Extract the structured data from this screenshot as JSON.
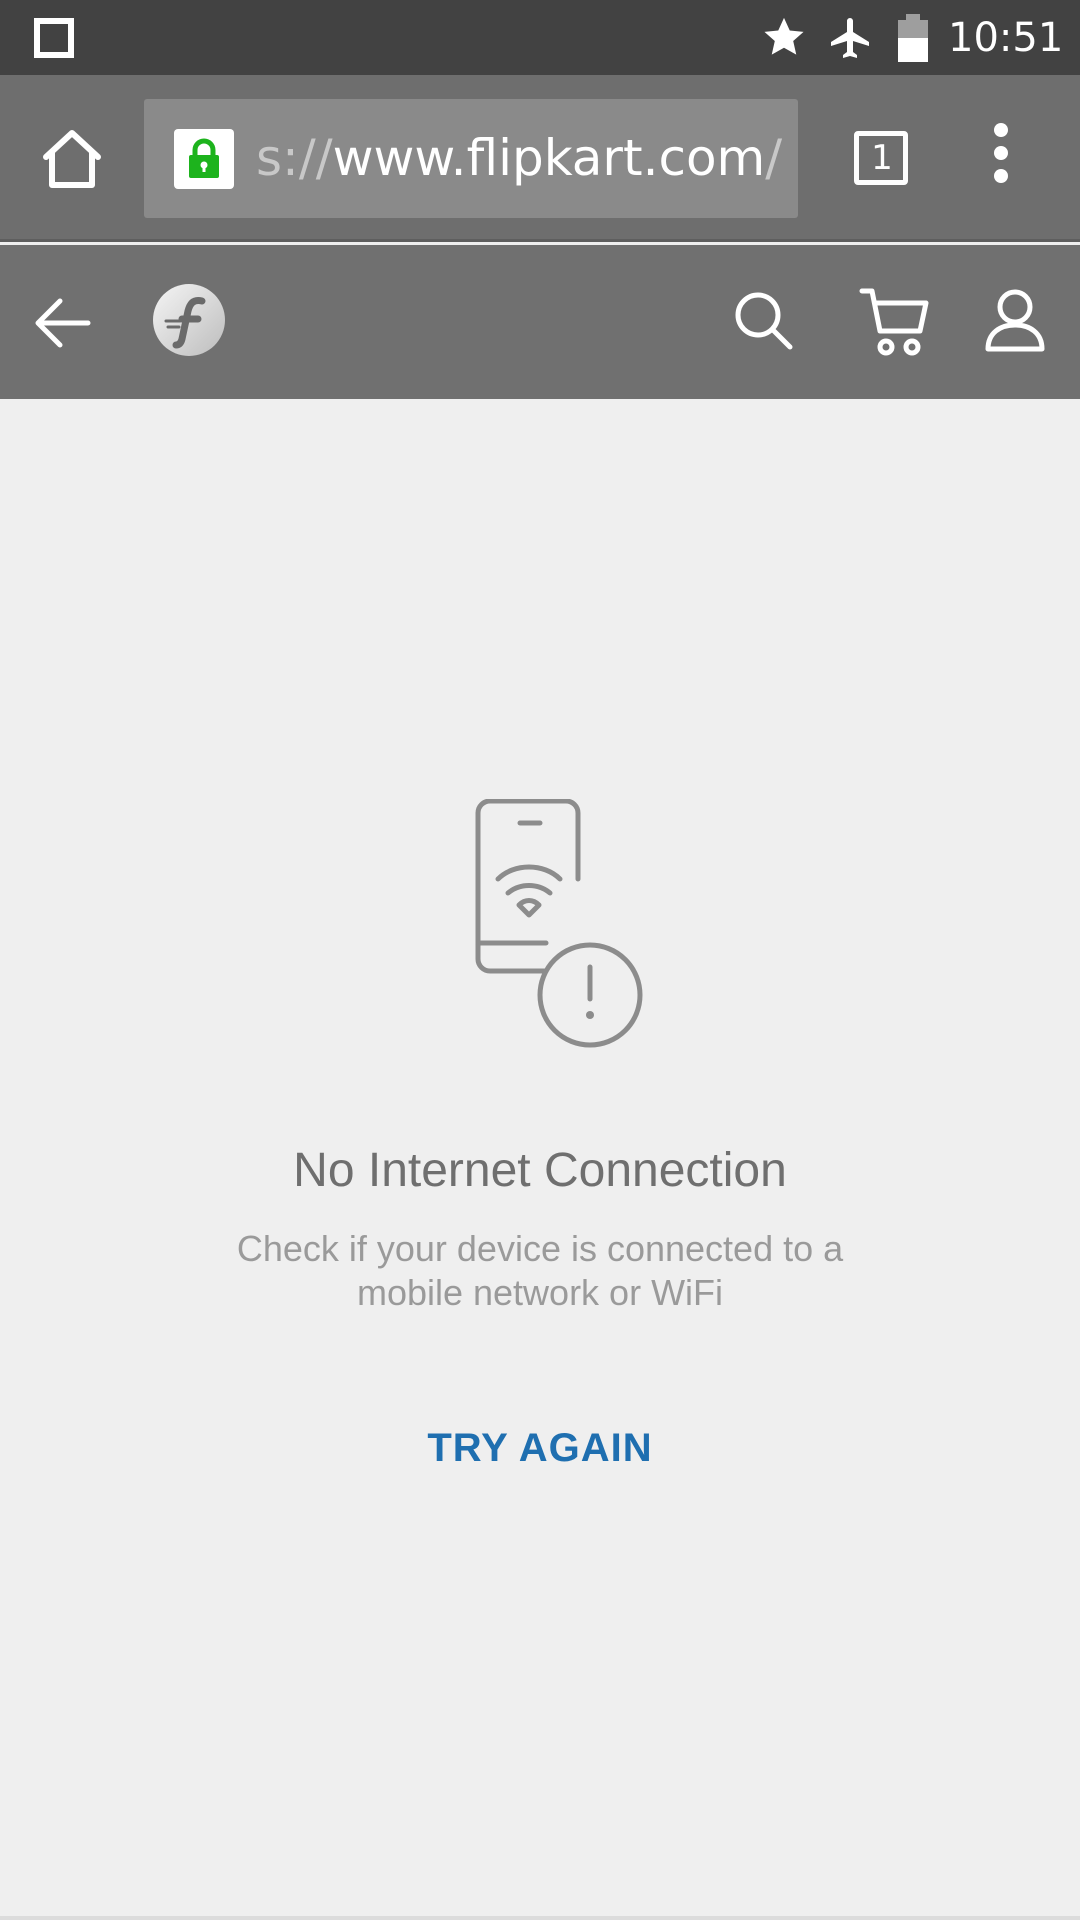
{
  "status_bar": {
    "time": "10:51",
    "icons": [
      "square-notification-icon",
      "star-icon",
      "airplane-mode-icon",
      "battery-icon"
    ]
  },
  "browser": {
    "url_prefix": "s://",
    "url_host": "www.flipkart.com",
    "url_suffix": "/r",
    "tab_count": "1",
    "icons": [
      "home-icon",
      "lock-icon",
      "tab-switcher-icon",
      "overflow-menu-icon"
    ],
    "lock_color": "#1db31d"
  },
  "header": {
    "icons": [
      "back-arrow-icon",
      "flipkart-logo",
      "search-icon",
      "cart-icon",
      "account-icon"
    ]
  },
  "main": {
    "illustration_icon": "phone-no-wifi-icon",
    "title": "No Internet Connection",
    "subtitle": "Check if your device is connected to a mobile network or WiFi",
    "retry_label": "TRY AGAIN",
    "accent_color": "#1f6fb0"
  }
}
